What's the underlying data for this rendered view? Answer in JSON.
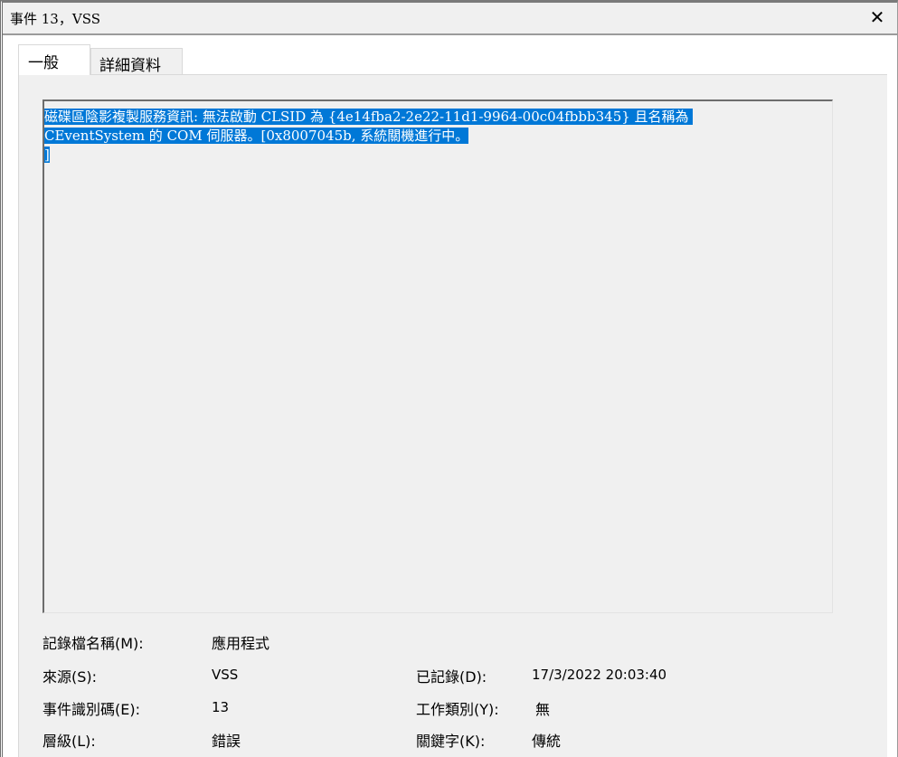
{
  "window": {
    "title": "事件 13，VSS",
    "close_icon": "close-icon"
  },
  "tabs": [
    {
      "label": "一般",
      "active": true
    },
    {
      "label": "詳細資料",
      "active": false
    }
  ],
  "description": {
    "lines": [
      "磁碟區陰影複製服務資訊: 無法啟動 CLSID 為 {4e14fba2-2e22-11d1-9964-00c04fbbb345} 且名稱為 ",
      "CEventSystem 的 COM 伺服器。[0x8007045b, 系統關機進行中。",
      "]"
    ],
    "selected": true,
    "selection_color": "#0078d7"
  },
  "fields": {
    "log_name": {
      "label": "記錄檔名稱(M):",
      "value": "應用程式"
    },
    "source": {
      "label": "來源(S):",
      "value": "VSS"
    },
    "logged": {
      "label": "已記錄(D):",
      "value": "17/3/2022 20:03:40"
    },
    "event_id": {
      "label": "事件識別碼(E):",
      "value": "13"
    },
    "task_category": {
      "label": "工作類別(Y):",
      "value": "無"
    },
    "level": {
      "label": "層級(L):",
      "value": "錯誤"
    },
    "keywords": {
      "label": "關鍵字(K):",
      "value": "傳統"
    }
  }
}
